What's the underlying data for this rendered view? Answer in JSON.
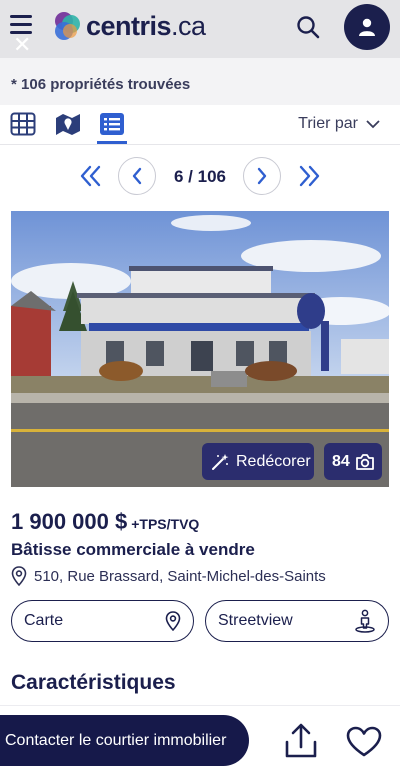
{
  "header": {
    "logo_main": "centris",
    "logo_tld": ".ca"
  },
  "results": {
    "text": "* 106 propriétés trouvées"
  },
  "toolbar": {
    "sort_label": "Trier par"
  },
  "pager": {
    "current": "6 / 106"
  },
  "listing": {
    "redecorate_label": "Redécorer",
    "photo_count": "84",
    "price": "1 900 000 $",
    "tax": "+TPS/TVQ",
    "type": "Bâtisse commerciale à vendre",
    "address": "510, Rue Brassard, Saint-Michel-des-Saints",
    "map_button": "Carte",
    "streetview_button": "Streetview"
  },
  "section": {
    "title": "Caractéristiques"
  },
  "bottom": {
    "contact_label": "Contacter le courtier immobilier"
  },
  "colors": {
    "brand_navy": "#1b1f4d",
    "accent_blue": "#2f5fd0",
    "logo_purple": "#7b3fa0",
    "logo_teal": "#2fb3a8"
  }
}
